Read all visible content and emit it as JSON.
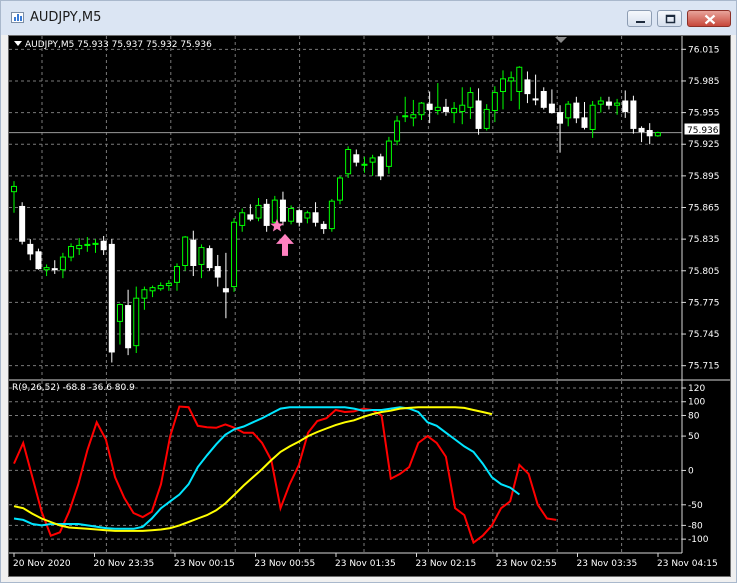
{
  "window": {
    "title": "AUDJPY,M5"
  },
  "chart": {
    "info": "AUDJPY,M5  75.933 75.937 75.932 75.936",
    "price_ticks": [
      "76.015",
      "75.985",
      "75.955",
      "75.925",
      "75.895",
      "75.865",
      "75.835",
      "75.805",
      "75.775",
      "75.745",
      "75.715"
    ],
    "current_price": "75.936",
    "indicator_label": "R(9,26,52) -68.8 -36.6 80.9",
    "indicator_ticks": [
      "120",
      "100",
      "80",
      "50",
      "0",
      "-50",
      "-80",
      "-100"
    ],
    "time_ticks": [
      "20 Nov 2020",
      "20 Nov 23:35",
      "23 Nov 00:15",
      "23 Nov 00:55",
      "23 Nov 01:35",
      "23 Nov 02:15",
      "23 Nov 02:55",
      "23 Nov 03:35",
      "23 Nov 04:15"
    ],
    "colors": {
      "bull": "#00ff00",
      "bear": "#ffffff",
      "fast": "#ff0000",
      "mid": "#00e5ff",
      "slow": "#ffff00",
      "signal": "#ff80c0",
      "grid": "#7a7a7a"
    },
    "icons": {
      "signal_star": "star-icon",
      "signal_arrow": "up-arrow-icon"
    }
  },
  "chart_data": [
    {
      "type": "candlestick",
      "title": "AUDJPY,M5",
      "x": [
        "20 Nov 2020",
        "20 Nov 23:35",
        "23 Nov 00:15",
        "23 Nov 00:55",
        "23 Nov 01:35",
        "23 Nov 02:15",
        "23 Nov 02:55",
        "23 Nov 03:35",
        "23 Nov 04:15"
      ],
      "ylim": [
        75.709,
        76.021
      ],
      "last": {
        "open": 75.933,
        "high": 75.937,
        "low": 75.932,
        "close": 75.936
      },
      "signals": [
        {
          "type": "buy",
          "price": 75.84
        }
      ],
      "candles": [
        [
          75.88,
          75.89,
          75.86,
          75.885
        ],
        [
          75.866,
          75.87,
          75.83,
          75.833
        ],
        [
          75.83,
          75.835,
          75.815,
          75.821
        ],
        [
          75.823,
          75.826,
          75.806,
          75.807
        ],
        [
          75.806,
          75.811,
          75.8,
          75.808
        ],
        [
          75.807,
          75.815,
          75.802,
          75.806
        ],
        [
          75.806,
          75.822,
          75.798,
          75.818
        ],
        [
          75.818,
          75.831,
          75.814,
          75.828
        ],
        [
          75.826,
          75.836,
          75.82,
          75.829
        ],
        [
          75.829,
          75.837,
          75.823,
          75.83
        ],
        [
          75.83,
          75.835,
          75.822,
          75.831
        ],
        [
          75.833,
          75.838,
          75.82,
          75.825
        ],
        [
          75.83,
          75.835,
          75.718,
          75.728
        ],
        [
          75.757,
          75.774,
          75.735,
          75.773
        ],
        [
          75.772,
          75.787,
          75.725,
          75.732
        ],
        [
          75.734,
          75.79,
          75.727,
          75.779
        ],
        [
          75.779,
          75.79,
          75.768,
          75.787
        ],
        [
          75.786,
          75.791,
          75.78,
          75.789
        ],
        [
          75.788,
          75.794,
          75.786,
          75.791
        ],
        [
          75.791,
          75.796,
          75.786,
          75.793
        ],
        [
          75.794,
          75.812,
          75.786,
          75.809
        ],
        [
          75.81,
          75.838,
          75.805,
          75.837
        ],
        [
          75.834,
          75.843,
          75.8,
          75.81
        ],
        [
          75.811,
          75.83,
          75.798,
          75.827
        ],
        [
          75.826,
          75.829,
          75.805,
          75.808
        ],
        [
          75.809,
          75.82,
          75.79,
          75.799
        ],
        [
          75.788,
          75.822,
          75.76,
          75.785
        ],
        [
          75.79,
          75.855,
          75.785,
          75.851
        ],
        [
          75.848,
          75.864,
          75.842,
          75.86
        ],
        [
          75.858,
          75.868,
          75.852,
          75.854
        ],
        [
          75.855,
          75.874,
          75.852,
          75.867
        ],
        [
          75.868,
          75.873,
          75.842,
          75.848
        ],
        [
          75.851,
          75.876,
          75.845,
          75.872
        ],
        [
          75.872,
          75.88,
          75.848,
          75.852
        ],
        [
          75.852,
          75.867,
          75.849,
          75.864
        ],
        [
          75.862,
          75.864,
          75.847,
          75.851
        ],
        [
          75.855,
          75.862,
          75.85,
          75.86
        ],
        [
          75.86,
          75.87,
          75.847,
          75.851
        ],
        [
          75.849,
          75.852,
          75.84,
          75.845
        ],
        [
          75.845,
          75.873,
          75.842,
          75.871
        ],
        [
          75.872,
          75.895,
          75.868,
          75.893
        ],
        [
          75.897,
          75.923,
          75.893,
          75.92
        ],
        [
          75.915,
          75.92,
          75.904,
          75.908
        ],
        [
          75.906,
          75.913,
          75.898,
          75.906
        ],
        [
          75.908,
          75.915,
          75.895,
          75.912
        ],
        [
          75.913,
          75.916,
          75.891,
          75.895
        ],
        [
          75.904,
          75.932,
          75.897,
          75.928
        ],
        [
          75.928,
          75.952,
          75.924,
          75.947
        ],
        [
          75.952,
          75.97,
          75.946,
          75.952
        ],
        [
          75.95,
          75.967,
          75.942,
          75.953
        ],
        [
          75.953,
          75.965,
          75.948,
          75.964
        ],
        [
          75.963,
          75.975,
          75.945,
          75.958
        ],
        [
          75.957,
          75.983,
          75.953,
          75.96
        ],
        [
          75.96,
          75.968,
          75.952,
          75.956
        ],
        [
          75.955,
          75.965,
          75.945,
          75.959
        ],
        [
          75.956,
          75.979,
          75.944,
          75.962
        ],
        [
          75.96,
          75.979,
          75.949,
          75.974
        ],
        [
          75.966,
          75.978,
          75.934,
          75.94
        ],
        [
          75.94,
          75.963,
          75.938,
          75.958
        ],
        [
          75.957,
          75.98,
          75.946,
          75.974
        ],
        [
          75.975,
          75.995,
          75.958,
          75.987
        ],
        [
          75.985,
          75.994,
          75.966,
          75.988
        ],
        [
          75.975,
          75.999,
          75.958,
          75.998
        ],
        [
          75.986,
          75.994,
          75.964,
          75.973
        ],
        [
          75.968,
          75.991,
          75.962,
          75.967
        ],
        [
          75.975,
          75.979,
          75.958,
          75.96
        ],
        [
          75.963,
          75.977,
          75.954,
          75.955
        ],
        [
          75.955,
          75.962,
          75.917,
          75.945
        ],
        [
          75.95,
          75.966,
          75.942,
          75.963
        ],
        [
          75.964,
          75.97,
          75.945,
          75.95
        ],
        [
          75.95,
          75.965,
          75.939,
          75.941
        ],
        [
          75.939,
          75.966,
          75.931,
          75.962
        ],
        [
          75.963,
          75.97,
          75.955,
          75.966
        ],
        [
          75.965,
          75.97,
          75.958,
          75.962
        ],
        [
          75.962,
          75.968,
          75.953,
          75.964
        ],
        [
          75.966,
          75.976,
          75.95,
          75.956
        ],
        [
          75.966,
          75.971,
          75.935,
          75.94
        ],
        [
          75.94,
          75.942,
          75.927,
          75.937
        ],
        [
          75.938,
          75.945,
          75.925,
          75.933
        ],
        [
          75.933,
          75.937,
          75.932,
          75.936
        ]
      ]
    },
    {
      "type": "line",
      "title": "R(9,26,52)",
      "ylim": [
        -110,
        120
      ],
      "current_values": [
        -68.8,
        -36.6,
        80.9
      ],
      "series": [
        {
          "color": "#ff0000",
          "values": [
            10,
            40,
            -10,
            -60,
            -95,
            -90,
            -60,
            -20,
            30,
            70,
            45,
            -10,
            -40,
            -62,
            -68,
            -60,
            -20,
            50,
            93,
            92,
            65,
            63,
            62,
            67,
            62,
            55,
            55,
            40,
            15,
            -55,
            -20,
            8,
            55,
            72,
            76,
            88,
            85,
            86,
            90,
            88,
            80,
            -12,
            -5,
            5,
            40,
            50,
            40,
            20,
            -55,
            -65,
            -105,
            -95,
            -80,
            -55,
            -45,
            8,
            -5,
            -50,
            -70,
            -72
          ]
        },
        {
          "color": "#00e5ff",
          "values": [
            -70,
            -72,
            -78,
            -80,
            -78,
            -78,
            -78,
            -78,
            -80,
            -82,
            -84,
            -85,
            -85,
            -85,
            -82,
            -70,
            -55,
            -45,
            -35,
            -20,
            5,
            22,
            38,
            52,
            60,
            64,
            70,
            76,
            83,
            90,
            92,
            92,
            92,
            92,
            92,
            92,
            92,
            90,
            87,
            88,
            88,
            90,
            92,
            90,
            85,
            70,
            65,
            55,
            45,
            35,
            27,
            10,
            -10,
            -20,
            -25,
            -35
          ]
        },
        {
          "color": "#ffff00",
          "values": [
            -52,
            -55,
            -63,
            -70,
            -75,
            -80,
            -83,
            -84,
            -85,
            -86,
            -87,
            -88,
            -88,
            -88,
            -88,
            -87,
            -86,
            -84,
            -80,
            -75,
            -70,
            -65,
            -58,
            -48,
            -35,
            -22,
            -10,
            2,
            15,
            27,
            35,
            42,
            50,
            56,
            61,
            66,
            70,
            73,
            78,
            82,
            85,
            87,
            90,
            91,
            92,
            92,
            92,
            92,
            92,
            91,
            88,
            85,
            82
          ]
        }
      ]
    }
  ]
}
